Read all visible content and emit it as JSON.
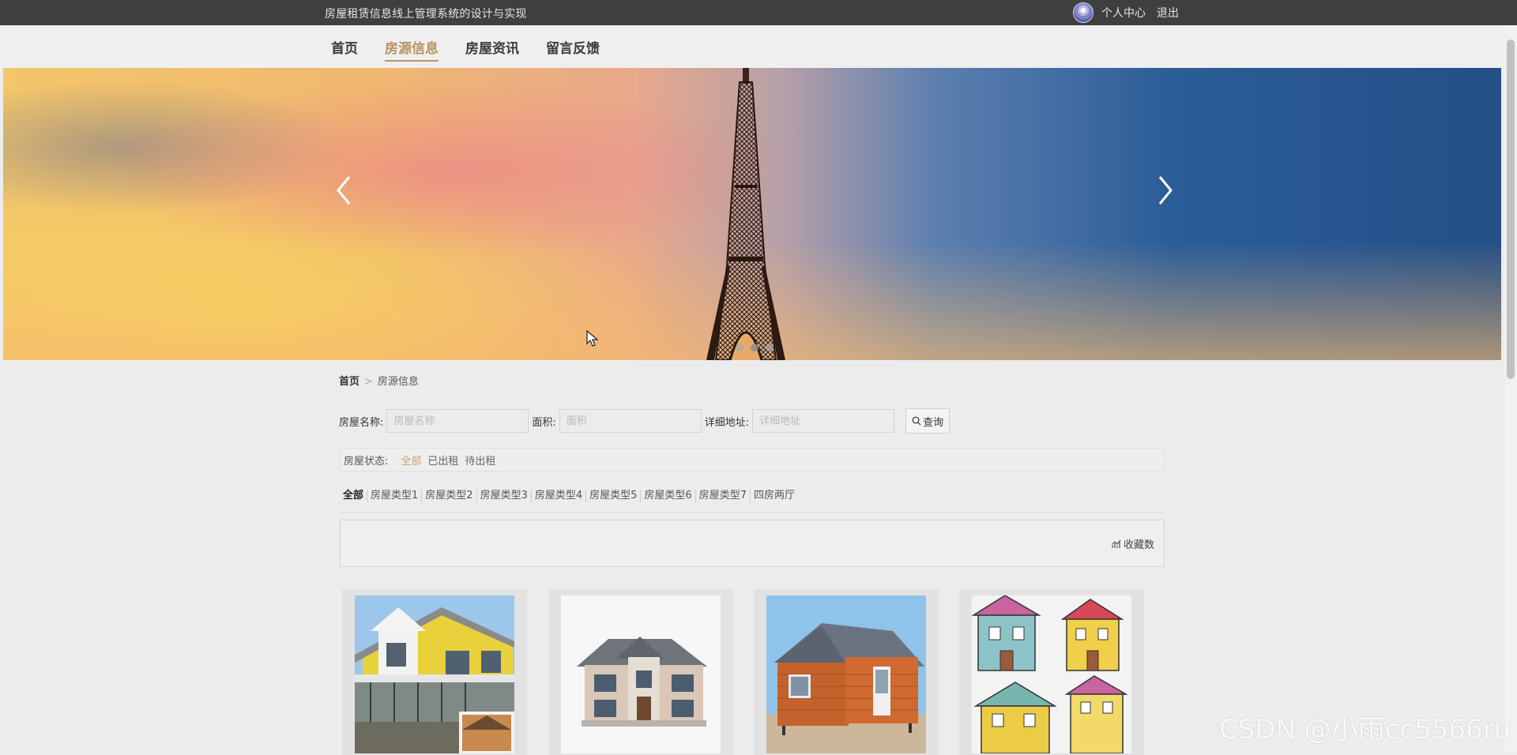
{
  "topbar": {
    "site_title": "房屋租赁信息线上管理系统的设计与实现",
    "user_center": "个人中心",
    "logout": "退出"
  },
  "nav": {
    "items": [
      {
        "label": "首页",
        "active": false
      },
      {
        "label": "房源信息",
        "active": true
      },
      {
        "label": "房屋资讯",
        "active": false
      },
      {
        "label": "留言反馈",
        "active": false
      }
    ]
  },
  "carousel": {
    "slide_count": 3,
    "active_index": 1
  },
  "breadcrumb": {
    "home": "首页",
    "separator": ">",
    "current": "房源信息"
  },
  "search": {
    "name_label": "房屋名称:",
    "name_placeholder": "房屋名称",
    "area_label": "面积:",
    "area_placeholder": "面积",
    "address_label": "详细地址:",
    "address_placeholder": "详细地址",
    "query_label": "查询"
  },
  "status_filter": {
    "label": "房屋状态:",
    "options": [
      "全部",
      "已出租",
      "待出租"
    ],
    "selected": "全部"
  },
  "type_filter": {
    "options": [
      "全部",
      "房屋类型1",
      "房屋类型2",
      "房屋类型3",
      "房屋类型4",
      "房屋类型5",
      "房屋类型6",
      "房屋类型7",
      "四房两厅"
    ]
  },
  "sort": {
    "favorites_label": "收藏数"
  },
  "listings": [
    {
      "image": "yellow-two-story-house"
    },
    {
      "image": "grey-stone-villa"
    },
    {
      "image": "orange-wooden-cabin"
    },
    {
      "image": "cartoon-houses"
    }
  ],
  "watermark": "CSDN @小雨cc5566ru",
  "colors": {
    "topbar_bg": "#3f3f3f",
    "accent": "#b89364",
    "page_bg": "#ececec"
  }
}
